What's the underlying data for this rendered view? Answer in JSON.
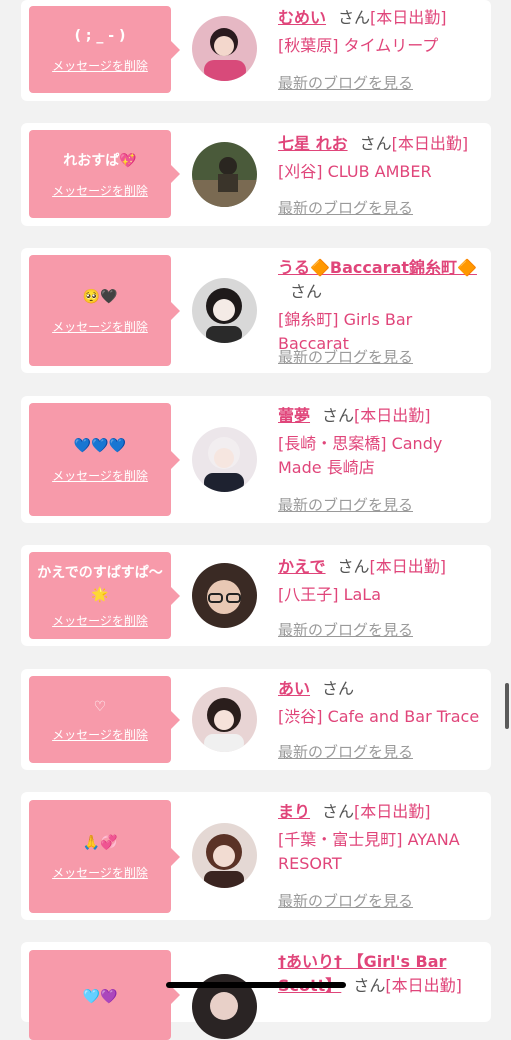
{
  "delete_label": "メッセージを削除",
  "blog_label": "最新のブログを見る",
  "san_suffix": "さん",
  "colors": {
    "bubble": "#f79aaa",
    "name": "#e0457a",
    "card": "#ffffff",
    "background": "#f2f2f2"
  },
  "cards": [
    {
      "message": "( ; _ - )",
      "name": "むめい",
      "status": "[本日出勤]",
      "shop": "[秋葉原] タイムリープ"
    },
    {
      "message": "れおすぱ💖",
      "name": "七星 れお",
      "status": "[本日出勤]",
      "shop": "[刈谷] CLUB AMBER"
    },
    {
      "message": "🥺🖤",
      "name": "うる🔶Baccarat錦糸町🔶",
      "status": "",
      "shop": "[錦糸町] Girls Bar Baccarat"
    },
    {
      "message": "💙💙💙",
      "name": "蕾夢",
      "status": "[本日出勤]",
      "shop": "[長崎・思案橋] Candy Made 長崎店"
    },
    {
      "message": "かえでのすぱすぱ〜🌟",
      "name": "かえで",
      "status": "[本日出勤]",
      "shop": "[八王子] LaLa"
    },
    {
      "message": "♡",
      "name": "あい",
      "status": "",
      "shop": "[渋谷] Cafe and Bar Trace"
    },
    {
      "message": "🙏💞",
      "name": "まり",
      "status": "[本日出勤]",
      "shop": "[千葉・富士見町] AYANA RESORT"
    },
    {
      "message": "🩵💜",
      "name": "†あいり† 【Girl's Bar Scott】",
      "status": "[本日出勤]",
      "shop": ""
    }
  ]
}
